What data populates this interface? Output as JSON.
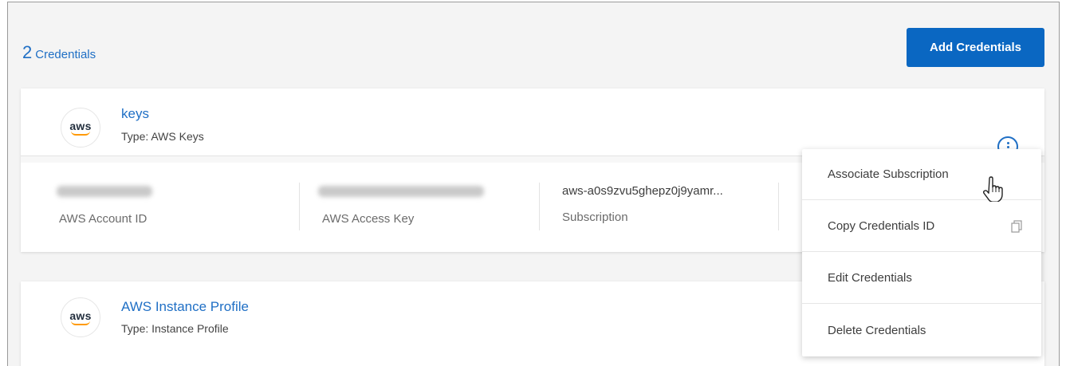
{
  "header": {
    "count": "2",
    "count_label": "Credentials",
    "add_button_label": "Add Credentials"
  },
  "credentials": [
    {
      "logo_text": "aws",
      "name": "keys",
      "type": "Type: AWS Keys",
      "fields": {
        "account_id_label": "AWS Account ID",
        "access_key_label": "AWS Access Key",
        "subscription_value": "aws-a0s9zvu5ghepz0j9yamr...",
        "subscription_label": "Subscription"
      }
    },
    {
      "logo_text": "aws",
      "name": "AWS Instance Profile",
      "type": "Type: Instance Profile"
    }
  ],
  "actions_menu": {
    "items": [
      "Associate Subscription",
      "Copy Credentials ID",
      "Edit Credentials",
      "Delete Credentials"
    ]
  },
  "icons": {
    "kebab": "more-options-icon",
    "copy": "copy-icon",
    "cursor": "hand-pointer-icon"
  },
  "colors": {
    "accent": "#0a67c2",
    "link": "#1f6fc5",
    "aws_orange": "#ff9900"
  }
}
